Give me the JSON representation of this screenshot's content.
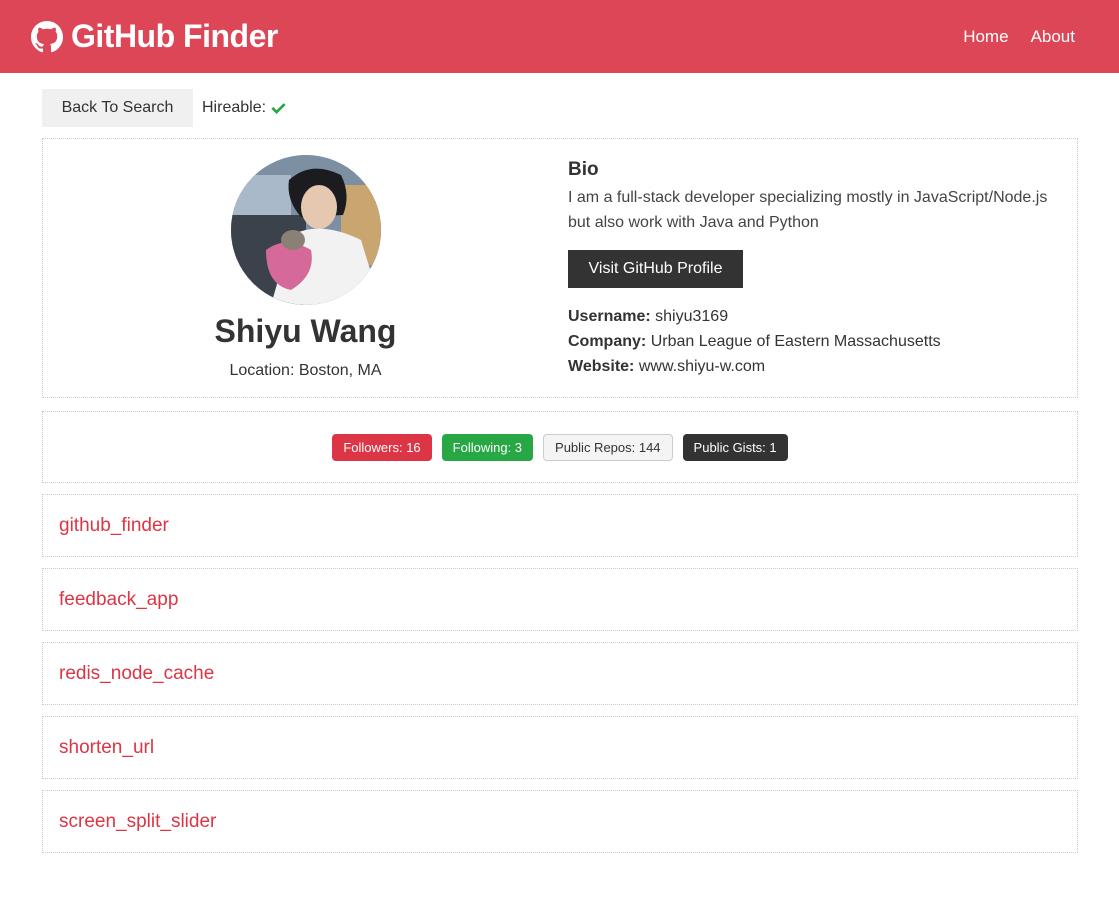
{
  "navbar": {
    "brand_icon": "github-icon",
    "title": "GitHub Finder",
    "links": [
      "Home",
      "About"
    ],
    "color": "#dc4656"
  },
  "topbar": {
    "back_label": "Back To Search",
    "hireable_label": "Hireable:",
    "hireable_icon": "check-icon"
  },
  "profile": {
    "avatar": "avatar-photo",
    "name": "Shiyu Wang",
    "location": "Location: Boston, MA",
    "bio_heading": "Bio",
    "bio": "I am a full-stack developer specializing mostly in JavaScript/Node.js but also work with Java and Python",
    "visit_label": "Visit GitHub Profile",
    "username_label": "Username:",
    "username": "shiyu3169",
    "company_label": "Company:",
    "company": "Urban League of Eastern Massachusetts",
    "website_label": "Website:",
    "website": "www.shiyu-w.com"
  },
  "stats": {
    "followers": "Followers: 16",
    "following": "Following: 3",
    "public_repos": "Public Repos: 144",
    "public_gists": "Public Gists: 1"
  },
  "repos": [
    "github_finder",
    "feedback_app",
    "redis_node_cache",
    "shorten_url",
    "screen_split_slider"
  ],
  "colors": {
    "accent": "#dc3545",
    "success": "#28a745",
    "dark": "#333333"
  }
}
